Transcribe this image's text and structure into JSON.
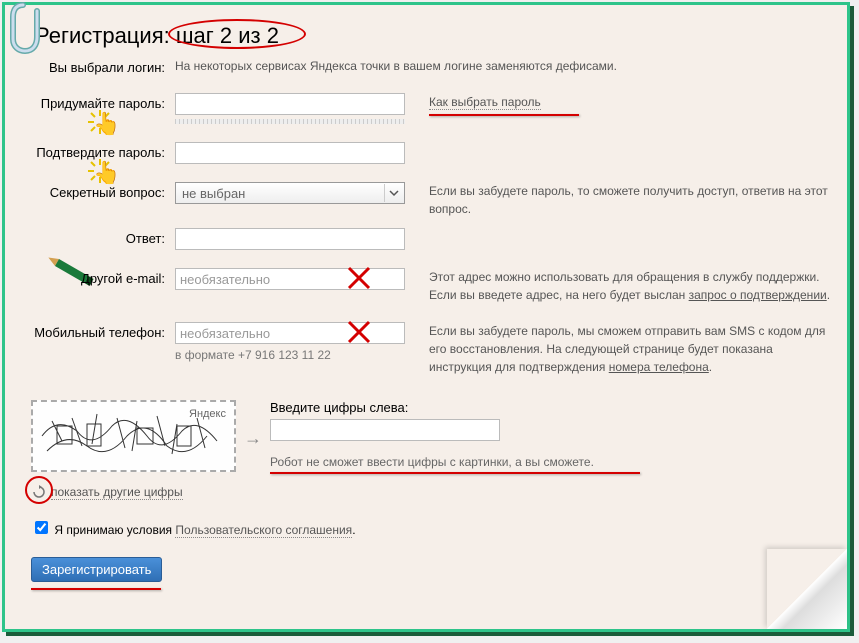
{
  "title": {
    "prefix": "Регистрация: ",
    "step": "шаг 2 из 2"
  },
  "login_chosen": {
    "label": "Вы выбрали логин:",
    "note": "На некоторых сервисах Яндекса точки в вашем логине заменяются дефисами."
  },
  "password": {
    "label": "Придумайте пароль:",
    "tip_link": "Как выбрать пароль"
  },
  "confirm": {
    "label": "Подтвердите пароль:"
  },
  "secret": {
    "label": "Секретный вопрос:",
    "selected": "не выбран",
    "note": "Если вы забудете пароль, то сможете получить доступ, ответив на этот вопрос."
  },
  "answer": {
    "label": "Ответ:"
  },
  "email": {
    "label": "Другой e-mail:",
    "placeholder": "необязательно",
    "note_a": "Этот адрес можно использовать для обращения в службу поддержки. Если вы введете адрес, на него будет выслан ",
    "note_link": "запрос о подтверждении",
    "note_b": "."
  },
  "phone": {
    "label": "Мобильный телефон:",
    "placeholder": "необязательно",
    "hint": "в формате +7 916 123 11 22",
    "note_a": "Если вы забудете пароль, мы сможем отправить вам SMS с кодом для его восстановления. На следующей странице будет показана инструкция для подтверждения ",
    "note_link": "номера телефона",
    "note_b": "."
  },
  "captcha": {
    "tag": "Яндекс",
    "title": "Введите цифры слева:",
    "hint": "Робот не сможет ввести цифры с картинки, а вы сможете.",
    "refresh": "показать другие цифры"
  },
  "tos": {
    "prefix": "Я принимаю условия ",
    "link": "Пользовательского соглашения",
    "suffix": "."
  },
  "submit": "Зарегистрировать"
}
